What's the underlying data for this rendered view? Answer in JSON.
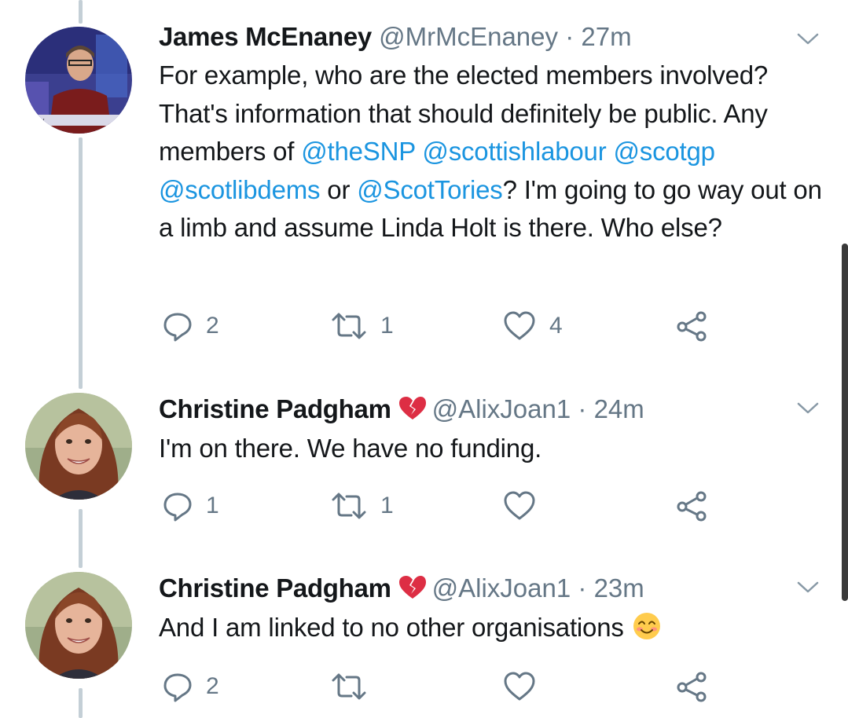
{
  "tweets": [
    {
      "author": "James McEnaney",
      "handle": "@MrMcEnaney",
      "separator": "·",
      "time": "27m",
      "avatar_label": "ney",
      "text_parts": [
        {
          "t": "For example, who are the elected members involved? That's information that should definitely be public. Any members of ",
          "m": false
        },
        {
          "t": "@theSNP",
          "m": true
        },
        {
          "t": " ",
          "m": false
        },
        {
          "t": "@scottishlabour",
          "m": true
        },
        {
          "t": " ",
          "m": false
        },
        {
          "t": "@scotgp",
          "m": true
        },
        {
          "t": " ",
          "m": false
        },
        {
          "t": "@scotlibdems",
          "m": true
        },
        {
          "t": " or ",
          "m": false
        },
        {
          "t": "@ScotTories",
          "m": true
        },
        {
          "t": "? I'm going to go way out on a limb and assume Linda Holt is there. Who else?",
          "m": false
        }
      ],
      "replies": "2",
      "retweets": "1",
      "likes": "4"
    },
    {
      "author": "Christine Padgham",
      "name_emoji": "broken-heart",
      "handle": "@AlixJoan1",
      "separator": "·",
      "time": "24m",
      "text": "I'm on there. We have no funding.",
      "replies": "1",
      "retweets": "1",
      "likes": ""
    },
    {
      "author": "Christine Padgham",
      "name_emoji": "broken-heart",
      "handle": "@AlixJoan1",
      "separator": "·",
      "time": "23m",
      "text": "And I am linked to no other organisations",
      "text_emoji": "smiling-face",
      "replies": "2",
      "retweets": "",
      "likes": ""
    }
  ],
  "colors": {
    "mention": "#1b95e0",
    "secondary": "#657786",
    "thread_line": "#c4cfd6"
  }
}
